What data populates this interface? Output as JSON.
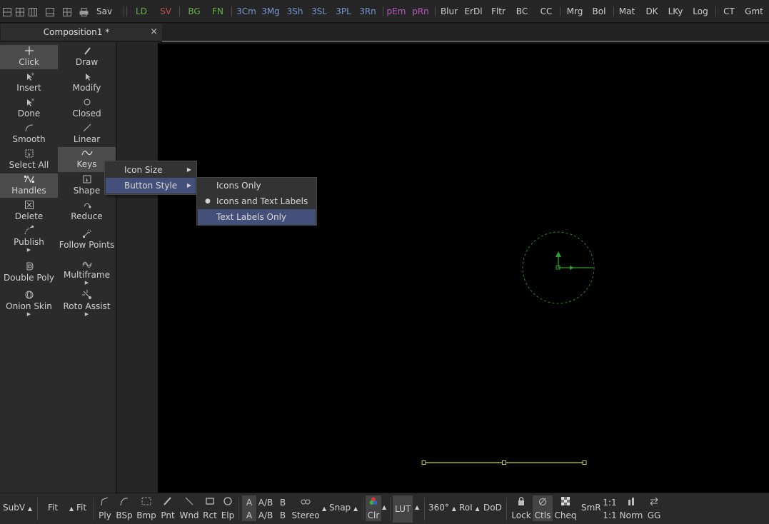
{
  "top_toolbar": {
    "save_label": "Sav",
    "buttons": [
      {
        "label": "LD",
        "color": "#69b04a"
      },
      {
        "label": "SV",
        "color": "#c05050"
      },
      {
        "label": "BG",
        "color": "#69b04a"
      },
      {
        "label": "FN",
        "color": "#69b04a"
      },
      {
        "label": "3Cm",
        "color": "#7d95cf"
      },
      {
        "label": "3Mg",
        "color": "#7d95cf"
      },
      {
        "label": "3Sh",
        "color": "#7d95cf"
      },
      {
        "label": "3SL",
        "color": "#7d95cf"
      },
      {
        "label": "3PL",
        "color": "#7d95cf"
      },
      {
        "label": "3Rn",
        "color": "#7d95cf"
      },
      {
        "label": "pEm",
        "color": "#b45bbd"
      },
      {
        "label": "pRn",
        "color": "#b45bbd"
      },
      {
        "label": "Blur",
        "color": "#cfcfcf"
      },
      {
        "label": "ErDl",
        "color": "#cfcfcf"
      },
      {
        "label": "Fltr",
        "color": "#cfcfcf"
      },
      {
        "label": "BC",
        "color": "#cfcfcf"
      },
      {
        "label": "CC",
        "color": "#cfcfcf"
      },
      {
        "label": "Mrg",
        "color": "#cfcfcf"
      },
      {
        "label": "Bol",
        "color": "#cfcfcf"
      },
      {
        "label": "Mat",
        "color": "#cfcfcf"
      },
      {
        "label": "DK",
        "color": "#cfcfcf"
      },
      {
        "label": "LKy",
        "color": "#cfcfcf"
      },
      {
        "label": "Log",
        "color": "#cfcfcf"
      },
      {
        "label": "CT",
        "color": "#cfcfcf"
      },
      {
        "label": "Gmt",
        "color": "#cfcfcf"
      }
    ]
  },
  "tab": {
    "title": "Composition1 *",
    "close": "×"
  },
  "tools": [
    {
      "label": "Click",
      "icon": "plus-icon"
    },
    {
      "label": "Draw",
      "icon": "pen-icon"
    },
    {
      "label": "Insert",
      "icon": "insert-point-icon"
    },
    {
      "label": "Modify",
      "icon": "cursor-icon"
    },
    {
      "label": "Done",
      "icon": "done-cursor-icon"
    },
    {
      "label": "Closed",
      "icon": "closed-shape-icon"
    },
    {
      "label": "Smooth",
      "icon": "smooth-curve-icon"
    },
    {
      "label": "Linear",
      "icon": "linear-line-icon"
    },
    {
      "label": "Select All",
      "icon": "select-all-icon"
    },
    {
      "label": "Keys",
      "icon": "keys-wave-icon"
    },
    {
      "label": "Handles",
      "icon": "handles-icon"
    },
    {
      "label": "Shape",
      "icon": "shape-icon"
    },
    {
      "label": "Delete",
      "icon": "delete-icon"
    },
    {
      "label": "Reduce",
      "icon": "reduce-icon"
    },
    {
      "label": "Publish",
      "icon": "publish-icon"
    },
    {
      "label": "Follow Points",
      "icon": "follow-points-icon"
    },
    {
      "label": "Double Poly",
      "icon": "double-poly-icon"
    },
    {
      "label": "Multiframe",
      "icon": "multiframe-icon"
    },
    {
      "label": "Onion Skin",
      "icon": "onion-skin-icon"
    },
    {
      "label": "Roto Assist",
      "icon": "roto-assist-icon"
    }
  ],
  "context_menu": {
    "items": [
      {
        "label": "Icon Size",
        "submenu": "▶"
      },
      {
        "label": "Button Style",
        "submenu": "▶"
      }
    ]
  },
  "submenu": {
    "items": [
      {
        "label": "Icons Only",
        "selected": false
      },
      {
        "label": "Icons and Text Labels",
        "selected": true,
        "bullet": "●"
      },
      {
        "label": "Text Labels Only",
        "selected": false
      }
    ]
  },
  "viewer": {
    "colors": {
      "spline": "#c9c94f",
      "control": "#2ea02e"
    }
  },
  "bottom_toolbar": {
    "subv": "SubV",
    "fit1": "Fit",
    "fit2": "Fit",
    "ply": "Ply",
    "bsp": "BSp",
    "bmp": "Bmp",
    "pnt": "Pnt",
    "wnd": "Wnd",
    "rct": "Rct",
    "elp": "Elp",
    "a_top": "A",
    "a_label": "A",
    "ab_top": "A/B",
    "ab_label": "A/B",
    "b_top": "B",
    "b_label": "B",
    "stereo": "Stereo",
    "snap": "Snap",
    "clr": "Clr",
    "lut": "LUT",
    "deg": "360°",
    "roi": "RoI",
    "dod": "DoD",
    "lock": "Lock",
    "ctls": "Ctls",
    "cheq": "Cheq",
    "smr": "SmR",
    "ratio_top": "1:1",
    "ratio_label": "1:1",
    "norm": "Norm",
    "gg": "GG"
  }
}
